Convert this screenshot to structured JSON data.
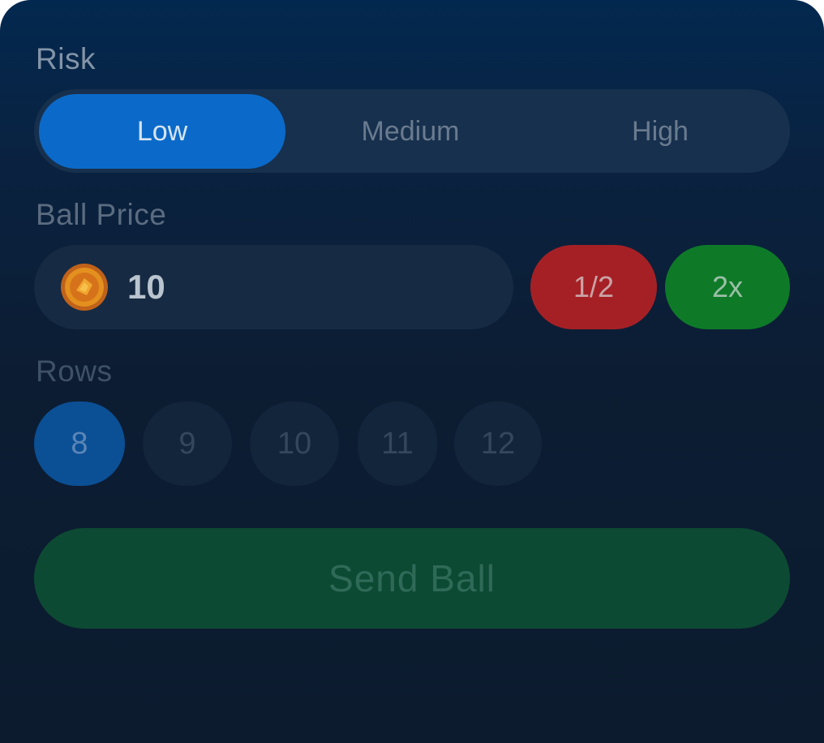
{
  "risk": {
    "label": "Risk",
    "options": [
      {
        "label": "Low",
        "selected": true
      },
      {
        "label": "Medium",
        "selected": false
      },
      {
        "label": "High",
        "selected": false
      }
    ]
  },
  "ball_price": {
    "label": "Ball Price",
    "value": "10",
    "icon": "coin-icon",
    "half_label": "1/2",
    "double_label": "2x"
  },
  "rows": {
    "label": "Rows",
    "options": [
      {
        "label": "8",
        "selected": true
      },
      {
        "label": "9",
        "selected": false
      },
      {
        "label": "10",
        "selected": false
      },
      {
        "label": "11",
        "selected": false
      },
      {
        "label": "12",
        "selected": false
      }
    ]
  },
  "send": {
    "label": "Send Ball"
  },
  "colors": {
    "accent_blue": "#0b6ac9",
    "half_red": "#a52025",
    "double_green": "#0e7a28",
    "send_green": "#0d4a33"
  }
}
